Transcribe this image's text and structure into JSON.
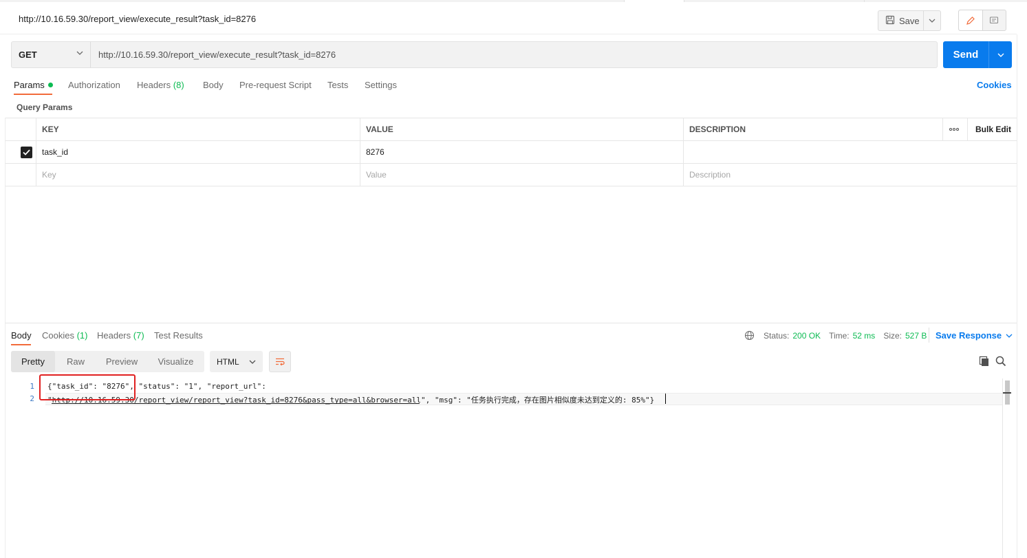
{
  "request": {
    "title": "http://10.16.59.30/report_view/execute_result?task_id=8276",
    "save_label": "Save",
    "method": "GET",
    "url": "http://10.16.59.30/report_view/execute_result?task_id=8276",
    "send_label": "Send"
  },
  "request_tabs": {
    "params": "Params",
    "authorization": "Authorization",
    "headers": "Headers",
    "headers_count": "(8)",
    "body": "Body",
    "pre_request": "Pre-request Script",
    "tests": "Tests",
    "settings": "Settings",
    "cookies": "Cookies"
  },
  "query_params": {
    "label": "Query Params",
    "columns": {
      "key": "KEY",
      "value": "VALUE",
      "description": "DESCRIPTION",
      "bulk_edit": "Bulk Edit"
    },
    "rows": [
      {
        "key": "task_id",
        "value": "8276",
        "description": "",
        "checked": true
      }
    ],
    "placeholders": {
      "key": "Key",
      "value": "Value",
      "description": "Description"
    }
  },
  "response_tabs": {
    "body": "Body",
    "cookies": "Cookies",
    "cookies_count": "(1)",
    "headers": "Headers",
    "headers_count": "(7)",
    "test_results": "Test Results"
  },
  "response_status": {
    "status_label": "Status:",
    "status_value": "200 OK",
    "time_label": "Time:",
    "time_value": "52 ms",
    "size_label": "Size:",
    "size_value": "527 B",
    "save_response": "Save Response"
  },
  "response_view": {
    "options": [
      "Pretty",
      "Raw",
      "Preview",
      "Visualize"
    ],
    "selected": "Pretty",
    "format": "HTML"
  },
  "response_body": {
    "line_numbers": [
      "1",
      "2"
    ],
    "line1": "{\"task_id\": \"8276\", \"status\": \"1\", \"report_url\":",
    "line2": "\"http://10.16.59.30/report_view/report_view?task_id=8276&pass_type=all&browser=all\", \"msg\": \"任务执行完成，存在图片相似度未达到定义的: 85%\"}"
  },
  "colors": {
    "accent_blue": "#097bed",
    "accent_orange": "#f26b3a",
    "status_green": "#0cbb52",
    "highlight_red": "#e02020"
  }
}
